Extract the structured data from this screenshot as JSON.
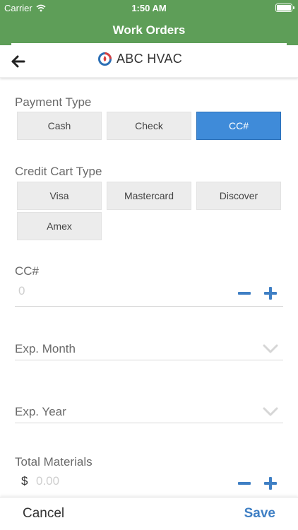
{
  "status_bar": {
    "carrier": "Carrier",
    "time": "1:50 AM"
  },
  "header": {
    "title": "Work Orders"
  },
  "sub_header": {
    "company": "ABC HVAC"
  },
  "payment_type": {
    "label": "Payment Type",
    "options": [
      "Cash",
      "Check",
      "CC#"
    ],
    "selected": "CC#"
  },
  "credit_card_type": {
    "label": "Credit Cart Type",
    "options": [
      "Visa",
      "Mastercard",
      "Discover",
      "Amex"
    ]
  },
  "cc_number": {
    "label": "CC#",
    "placeholder": "0"
  },
  "exp_month": {
    "label": "Exp. Month"
  },
  "exp_year": {
    "label": "Exp. Year"
  },
  "total_materials": {
    "label": "Total Materials",
    "currency": "$",
    "placeholder": "0.00"
  },
  "footer": {
    "cancel_label": "Cancel",
    "save_label": "Save"
  },
  "colors": {
    "header_green": "#5e9e58",
    "accent_blue": "#3f8bd9",
    "save_blue": "#3f7fc4"
  }
}
